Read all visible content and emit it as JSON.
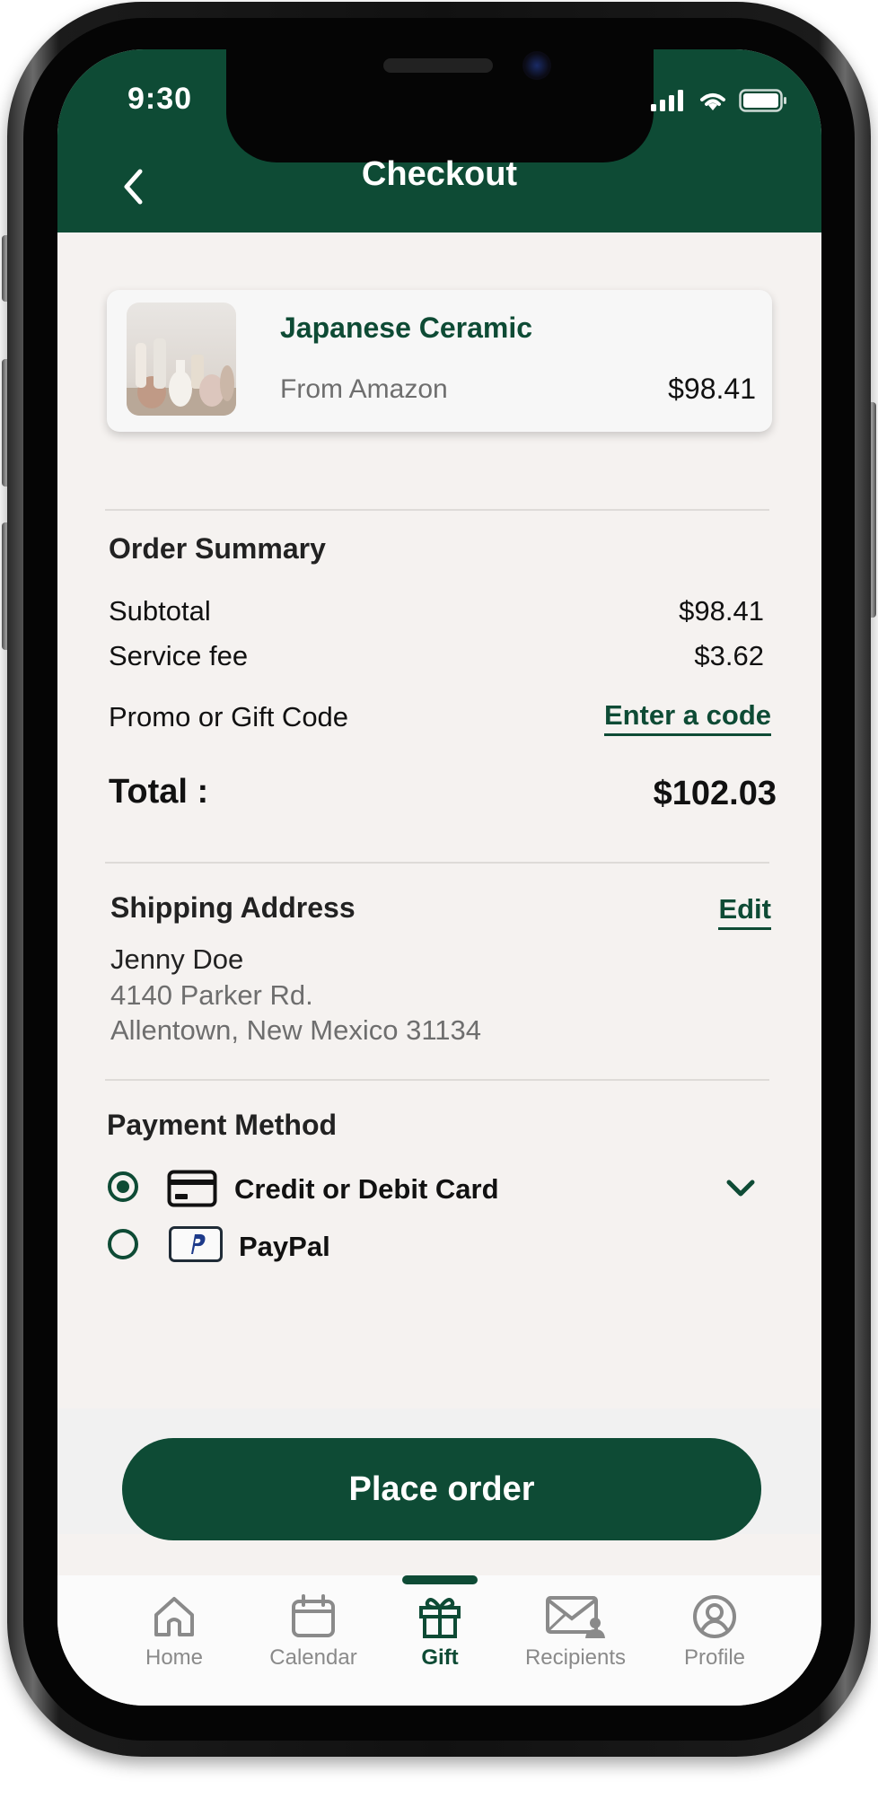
{
  "status_bar": {
    "time": "9:30"
  },
  "header": {
    "title": "Checkout",
    "back_icon": "chevron-left-icon"
  },
  "product": {
    "name": "Japanese Ceramic",
    "source": "From Amazon",
    "price": "$98.41"
  },
  "order_summary": {
    "title": "Order Summary",
    "subtotal_label": "Subtotal",
    "subtotal_value": "$98.41",
    "fee_label": "Service fee",
    "fee_value": "$3.62",
    "promo_label": "Promo or Gift Code",
    "promo_link": "Enter a code",
    "total_label": "Total :",
    "total_value": "$102.03"
  },
  "shipping": {
    "title": "Shipping Address",
    "edit_label": "Edit",
    "name": "Jenny Doe",
    "line1": "4140 Parker Rd.",
    "line2": "Allentown, New Mexico 31134"
  },
  "payment": {
    "title": "Payment Method",
    "options": [
      {
        "label": "Credit or Debit Card",
        "icon": "credit-card-icon",
        "selected": true
      },
      {
        "label": "PayPal",
        "icon": "paypal-icon",
        "selected": false
      }
    ]
  },
  "actions": {
    "place_order": "Place order"
  },
  "tabbar": {
    "items": [
      {
        "label": "Home",
        "icon": "home-icon"
      },
      {
        "label": "Calendar",
        "icon": "calendar-icon"
      },
      {
        "label": "Gift",
        "icon": "gift-icon",
        "active": true
      },
      {
        "label": "Recipients",
        "icon": "mail-user-icon"
      },
      {
        "label": "Profile",
        "icon": "profile-icon"
      }
    ]
  },
  "colors": {
    "brand": "#0e4b35",
    "background": "#f5f2f0"
  }
}
